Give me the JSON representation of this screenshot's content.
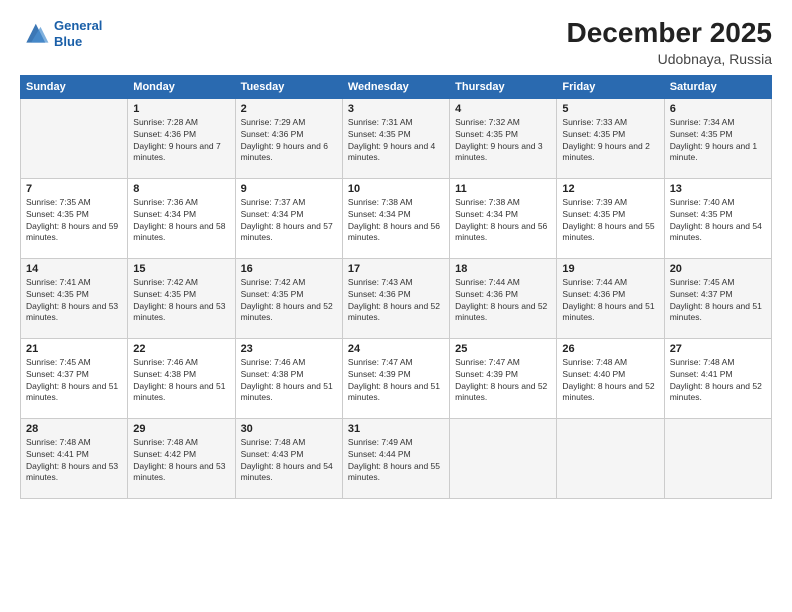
{
  "logo": {
    "line1": "General",
    "line2": "Blue"
  },
  "header": {
    "month": "December 2025",
    "location": "Udobnaya, Russia"
  },
  "weekdays": [
    "Sunday",
    "Monday",
    "Tuesday",
    "Wednesday",
    "Thursday",
    "Friday",
    "Saturday"
  ],
  "weeks": [
    [
      {
        "day": "",
        "sunrise": "",
        "sunset": "",
        "daylight": ""
      },
      {
        "day": "1",
        "sunrise": "Sunrise: 7:28 AM",
        "sunset": "Sunset: 4:36 PM",
        "daylight": "Daylight: 9 hours and 7 minutes."
      },
      {
        "day": "2",
        "sunrise": "Sunrise: 7:29 AM",
        "sunset": "Sunset: 4:36 PM",
        "daylight": "Daylight: 9 hours and 6 minutes."
      },
      {
        "day": "3",
        "sunrise": "Sunrise: 7:31 AM",
        "sunset": "Sunset: 4:35 PM",
        "daylight": "Daylight: 9 hours and 4 minutes."
      },
      {
        "day": "4",
        "sunrise": "Sunrise: 7:32 AM",
        "sunset": "Sunset: 4:35 PM",
        "daylight": "Daylight: 9 hours and 3 minutes."
      },
      {
        "day": "5",
        "sunrise": "Sunrise: 7:33 AM",
        "sunset": "Sunset: 4:35 PM",
        "daylight": "Daylight: 9 hours and 2 minutes."
      },
      {
        "day": "6",
        "sunrise": "Sunrise: 7:34 AM",
        "sunset": "Sunset: 4:35 PM",
        "daylight": "Daylight: 9 hours and 1 minute."
      }
    ],
    [
      {
        "day": "7",
        "sunrise": "Sunrise: 7:35 AM",
        "sunset": "Sunset: 4:35 PM",
        "daylight": "Daylight: 8 hours and 59 minutes."
      },
      {
        "day": "8",
        "sunrise": "Sunrise: 7:36 AM",
        "sunset": "Sunset: 4:34 PM",
        "daylight": "Daylight: 8 hours and 58 minutes."
      },
      {
        "day": "9",
        "sunrise": "Sunrise: 7:37 AM",
        "sunset": "Sunset: 4:34 PM",
        "daylight": "Daylight: 8 hours and 57 minutes."
      },
      {
        "day": "10",
        "sunrise": "Sunrise: 7:38 AM",
        "sunset": "Sunset: 4:34 PM",
        "daylight": "Daylight: 8 hours and 56 minutes."
      },
      {
        "day": "11",
        "sunrise": "Sunrise: 7:38 AM",
        "sunset": "Sunset: 4:34 PM",
        "daylight": "Daylight: 8 hours and 56 minutes."
      },
      {
        "day": "12",
        "sunrise": "Sunrise: 7:39 AM",
        "sunset": "Sunset: 4:35 PM",
        "daylight": "Daylight: 8 hours and 55 minutes."
      },
      {
        "day": "13",
        "sunrise": "Sunrise: 7:40 AM",
        "sunset": "Sunset: 4:35 PM",
        "daylight": "Daylight: 8 hours and 54 minutes."
      }
    ],
    [
      {
        "day": "14",
        "sunrise": "Sunrise: 7:41 AM",
        "sunset": "Sunset: 4:35 PM",
        "daylight": "Daylight: 8 hours and 53 minutes."
      },
      {
        "day": "15",
        "sunrise": "Sunrise: 7:42 AM",
        "sunset": "Sunset: 4:35 PM",
        "daylight": "Daylight: 8 hours and 53 minutes."
      },
      {
        "day": "16",
        "sunrise": "Sunrise: 7:42 AM",
        "sunset": "Sunset: 4:35 PM",
        "daylight": "Daylight: 8 hours and 52 minutes."
      },
      {
        "day": "17",
        "sunrise": "Sunrise: 7:43 AM",
        "sunset": "Sunset: 4:36 PM",
        "daylight": "Daylight: 8 hours and 52 minutes."
      },
      {
        "day": "18",
        "sunrise": "Sunrise: 7:44 AM",
        "sunset": "Sunset: 4:36 PM",
        "daylight": "Daylight: 8 hours and 52 minutes."
      },
      {
        "day": "19",
        "sunrise": "Sunrise: 7:44 AM",
        "sunset": "Sunset: 4:36 PM",
        "daylight": "Daylight: 8 hours and 51 minutes."
      },
      {
        "day": "20",
        "sunrise": "Sunrise: 7:45 AM",
        "sunset": "Sunset: 4:37 PM",
        "daylight": "Daylight: 8 hours and 51 minutes."
      }
    ],
    [
      {
        "day": "21",
        "sunrise": "Sunrise: 7:45 AM",
        "sunset": "Sunset: 4:37 PM",
        "daylight": "Daylight: 8 hours and 51 minutes."
      },
      {
        "day": "22",
        "sunrise": "Sunrise: 7:46 AM",
        "sunset": "Sunset: 4:38 PM",
        "daylight": "Daylight: 8 hours and 51 minutes."
      },
      {
        "day": "23",
        "sunrise": "Sunrise: 7:46 AM",
        "sunset": "Sunset: 4:38 PM",
        "daylight": "Daylight: 8 hours and 51 minutes."
      },
      {
        "day": "24",
        "sunrise": "Sunrise: 7:47 AM",
        "sunset": "Sunset: 4:39 PM",
        "daylight": "Daylight: 8 hours and 51 minutes."
      },
      {
        "day": "25",
        "sunrise": "Sunrise: 7:47 AM",
        "sunset": "Sunset: 4:39 PM",
        "daylight": "Daylight: 8 hours and 52 minutes."
      },
      {
        "day": "26",
        "sunrise": "Sunrise: 7:48 AM",
        "sunset": "Sunset: 4:40 PM",
        "daylight": "Daylight: 8 hours and 52 minutes."
      },
      {
        "day": "27",
        "sunrise": "Sunrise: 7:48 AM",
        "sunset": "Sunset: 4:41 PM",
        "daylight": "Daylight: 8 hours and 52 minutes."
      }
    ],
    [
      {
        "day": "28",
        "sunrise": "Sunrise: 7:48 AM",
        "sunset": "Sunset: 4:41 PM",
        "daylight": "Daylight: 8 hours and 53 minutes."
      },
      {
        "day": "29",
        "sunrise": "Sunrise: 7:48 AM",
        "sunset": "Sunset: 4:42 PM",
        "daylight": "Daylight: 8 hours and 53 minutes."
      },
      {
        "day": "30",
        "sunrise": "Sunrise: 7:48 AM",
        "sunset": "Sunset: 4:43 PM",
        "daylight": "Daylight: 8 hours and 54 minutes."
      },
      {
        "day": "31",
        "sunrise": "Sunrise: 7:49 AM",
        "sunset": "Sunset: 4:44 PM",
        "daylight": "Daylight: 8 hours and 55 minutes."
      },
      {
        "day": "",
        "sunrise": "",
        "sunset": "",
        "daylight": ""
      },
      {
        "day": "",
        "sunrise": "",
        "sunset": "",
        "daylight": ""
      },
      {
        "day": "",
        "sunrise": "",
        "sunset": "",
        "daylight": ""
      }
    ]
  ]
}
